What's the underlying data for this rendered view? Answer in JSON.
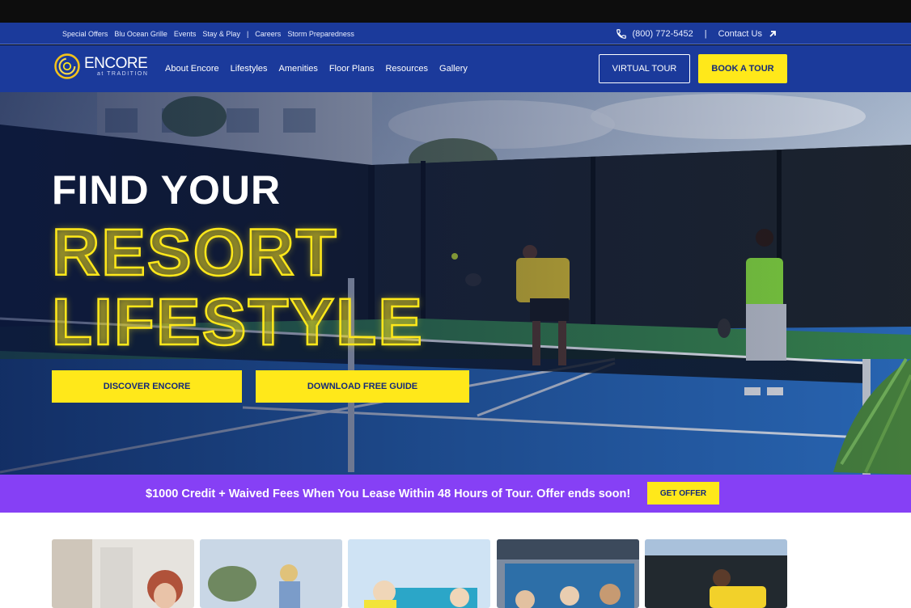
{
  "utility": {
    "links": [
      "Special Offers",
      "Blu Ocean Grille",
      "Events",
      "Stay & Play",
      "|",
      "Careers",
      "Storm Preparedness"
    ],
    "phone": "(800) 772-5452",
    "separator": "|",
    "contact": "Contact Us"
  },
  "logo": {
    "name": "ENCORE",
    "sub": "at TRADITION"
  },
  "nav": {
    "items": [
      "About Encore",
      "Lifestyles",
      "Amenities",
      "Floor Plans",
      "Resources",
      "Gallery"
    ],
    "virtual_tour": "VIRTUAL TOUR",
    "book_tour": "BOOK A TOUR"
  },
  "hero": {
    "line1": "FIND YOUR",
    "line2": "RESORT",
    "line3": "LIFESTYLE",
    "discover": "DISCOVER ENCORE",
    "guide": "DOWNLOAD FREE GUIDE"
  },
  "promo": {
    "text": "$1000 Credit + Waived Fees When You Lease Within 48 Hours of Tour. Offer ends soon!",
    "button": "GET OFFER"
  },
  "colors": {
    "brand_blue": "#1b3a9b",
    "accent_yellow": "#ffe81a",
    "promo_purple": "#8640f5"
  }
}
